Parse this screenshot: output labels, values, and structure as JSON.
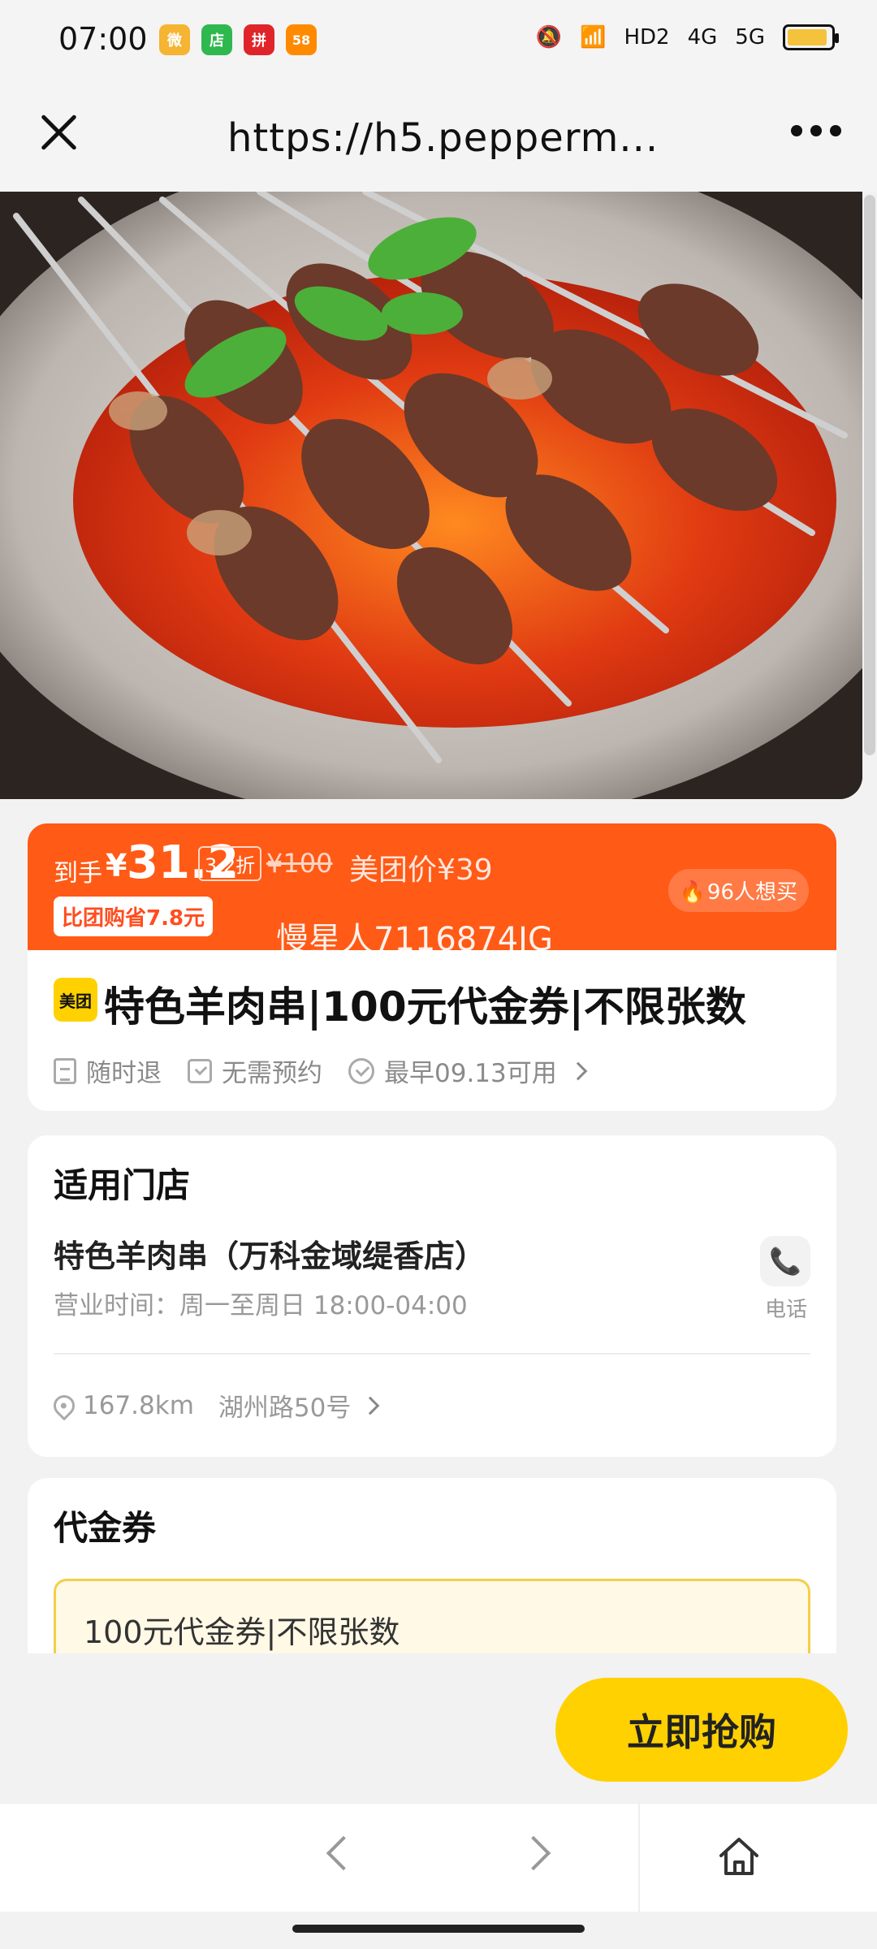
{
  "status_bar": {
    "time": "07:00",
    "apps": [
      {
        "icon": "weibo-icon",
        "color": "#f5b431",
        "glyph": "微"
      },
      {
        "icon": "store-icon",
        "color": "#2fb84f",
        "glyph": "店"
      },
      {
        "icon": "pinduoduo-icon",
        "color": "#e0252a",
        "glyph": "拼"
      },
      {
        "icon": "58-icon",
        "color": "#ff8a00",
        "glyph": "58"
      }
    ],
    "network": [
      "HD2",
      "4G",
      "5G"
    ],
    "battery_level": 0.92
  },
  "browser": {
    "url": "https://h5.pepperm...",
    "close_icon": "close-icon",
    "menu_icon": "more-icon"
  },
  "hero": {
    "image_alt": "lamb skewers"
  },
  "deal": {
    "price_label": "到手",
    "currency": "¥",
    "price": "31.2",
    "discount": "3.2折",
    "original_price": "¥100",
    "meituan_price": "美团价¥39",
    "save_tag": "比团购省7.8元",
    "watermark": "慢星人7116874JG",
    "want_count": "96人想买",
    "brand_logo": "美团",
    "title": "特色羊肉串|100元代金券|不限张数",
    "perks": [
      "随时退",
      "无需预约",
      "最早09.13可用"
    ]
  },
  "stores": {
    "title": "适用门店",
    "name": "特色羊肉串（万科金域缇香店）",
    "hours": "营业时间：周一至周日 18:00-04:00",
    "phone_label": "电话",
    "distance": "167.8km",
    "address": "湖州路50号"
  },
  "voucher": {
    "title": "代金券",
    "item": "100元代金券|不限张数"
  },
  "buy_button": "立即抢购",
  "accent": {
    "orange": "#ff5a16",
    "yellow": "#ffd100"
  }
}
